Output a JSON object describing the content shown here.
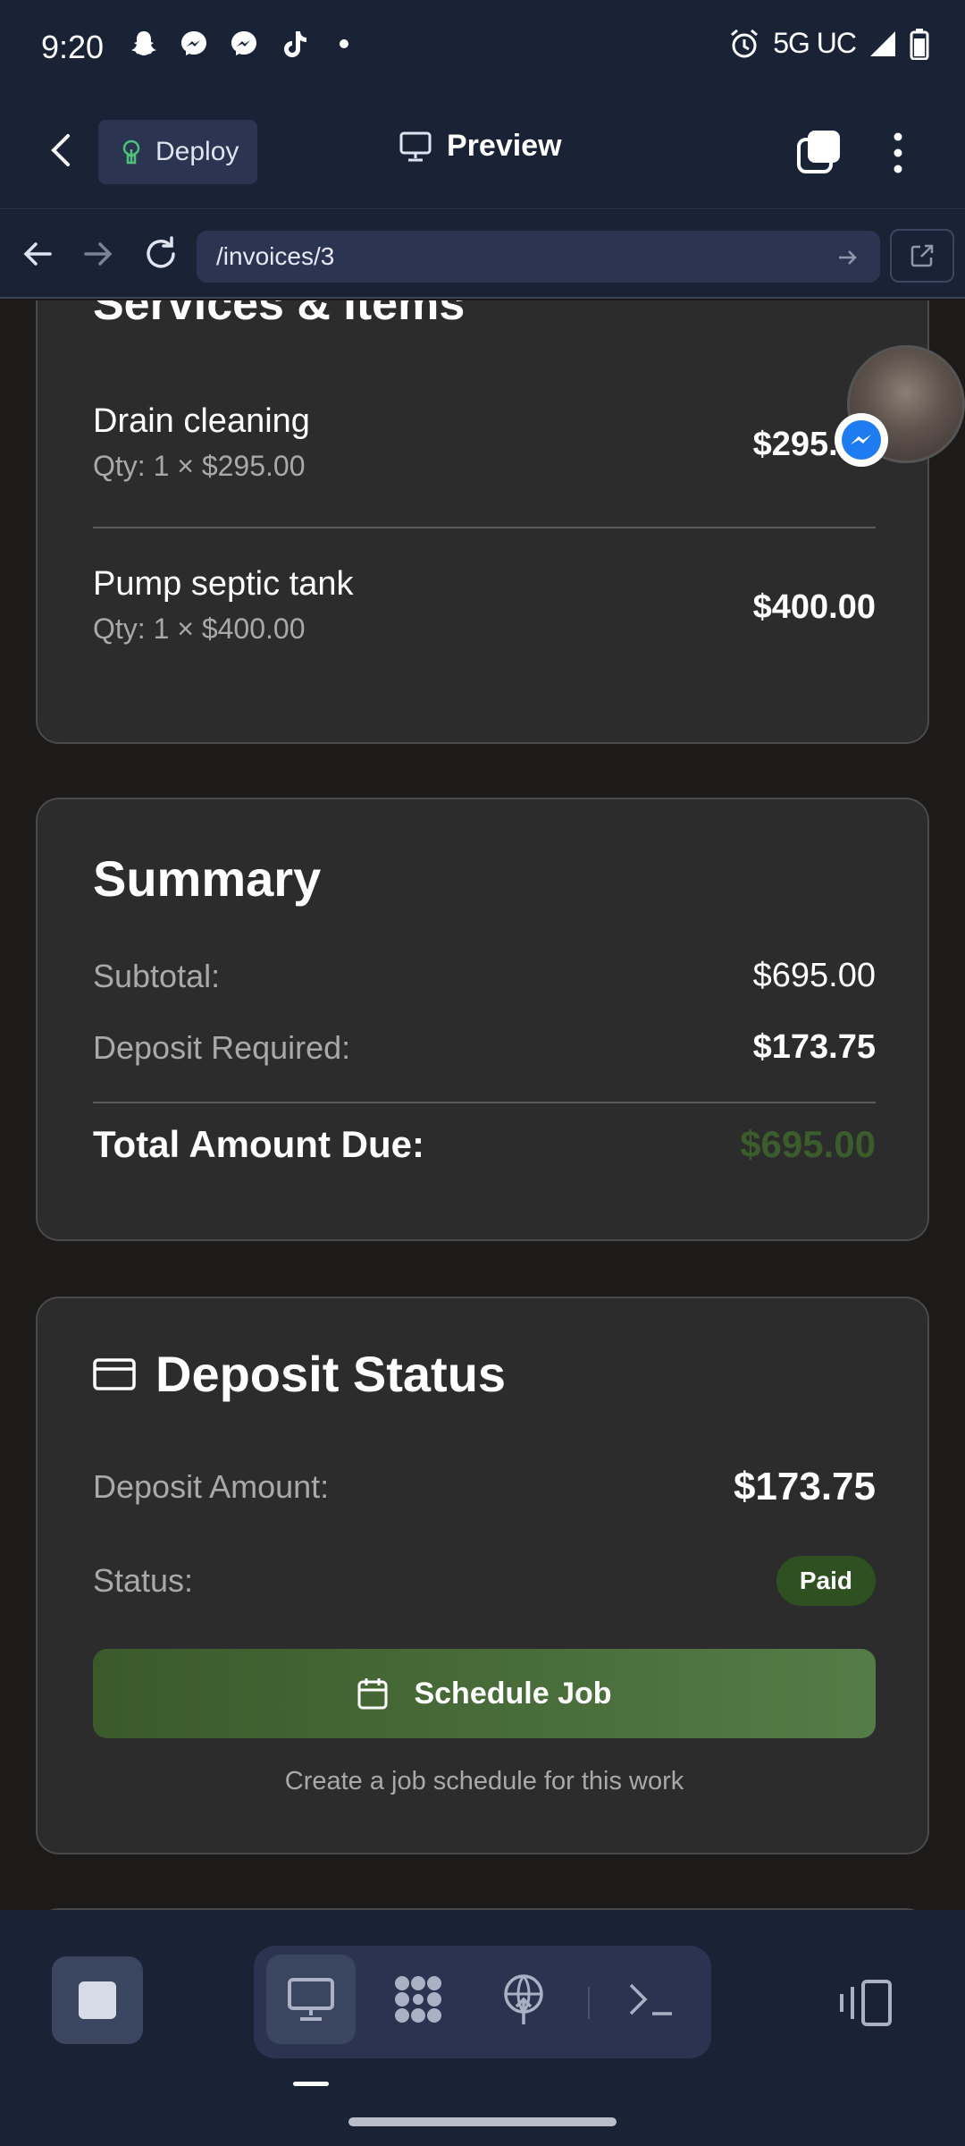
{
  "status_bar": {
    "time": "9:20",
    "network": "5G UC",
    "notification_icons": [
      "snapchat-icon",
      "messenger-icon",
      "messenger-icon",
      "tiktok-icon",
      "dot-icon"
    ]
  },
  "toolbar": {
    "deploy_label": "Deploy",
    "preview_label": "Preview"
  },
  "url_bar": {
    "url": "/invoices/3"
  },
  "items_card": {
    "title_partial": "Services & Items",
    "items": [
      {
        "name": "Drain cleaning",
        "qty": "Qty: 1 × $295.00",
        "price": "$295.00"
      },
      {
        "name": "Pump septic tank",
        "qty": "Qty: 1 × $400.00",
        "price": "$400.00"
      }
    ]
  },
  "summary": {
    "title": "Summary",
    "subtotal_label": "Subtotal:",
    "subtotal_value": "$695.00",
    "deposit_label": "Deposit Required:",
    "deposit_value": "$173.75",
    "total_label": "Total Amount Due:",
    "total_value": "$695.00",
    "total_color": "#3b5d2c"
  },
  "deposit_status": {
    "title": "Deposit Status",
    "amount_label": "Deposit Amount:",
    "amount_value": "$173.75",
    "status_label": "Status:",
    "status_value": "Paid",
    "schedule_label": "Schedule Job",
    "helper_text": "Create a job schedule for this work"
  },
  "colors": {
    "accent_green": "#557c46",
    "badge_green": "#2f5021",
    "app_bar": "#1a2236",
    "card_bg": "#2c2c2c"
  }
}
